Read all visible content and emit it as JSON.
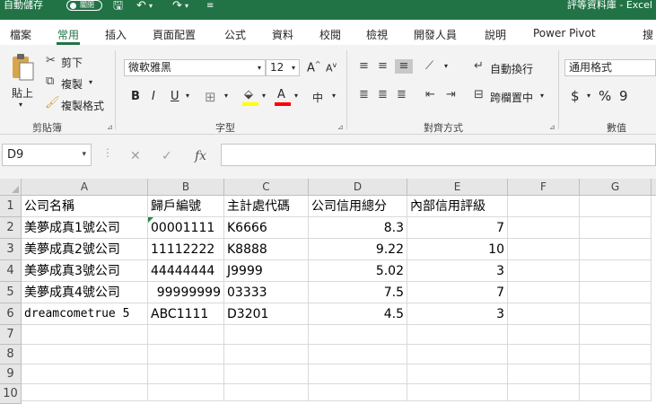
{
  "titlebar": {
    "autosave_label": "自動儲存",
    "autosave_state": "關閉",
    "title": "評等資料庫 - Excel"
  },
  "ribbon_tabs": [
    "檔案",
    "常用",
    "插入",
    "頁面配置",
    "公式",
    "資料",
    "校閱",
    "檢視",
    "開發人員",
    "說明",
    "Power Pivot",
    "搜"
  ],
  "active_tab": "常用",
  "clipboard": {
    "paste": "貼上",
    "cut": "剪下",
    "copy": "複製",
    "format_painter": "複製格式",
    "label": "剪貼簿"
  },
  "font": {
    "name": "微軟雅黑",
    "size": "12",
    "grow": "A",
    "shrink": "A",
    "bold": "B",
    "italic": "I",
    "underline": "U",
    "phonetic": "中",
    "label": "字型"
  },
  "alignment": {
    "wrap": "自動換行",
    "merge": "跨欄置中",
    "label": "對齊方式"
  },
  "number": {
    "format": "通用格式",
    "currency": "$",
    "percent": "%",
    "comma": "9",
    "label": "數值"
  },
  "formula_bar": {
    "name_box": "D9",
    "cancel": "✕",
    "enter": "✓",
    "fx": "fx",
    "formula": ""
  },
  "colors": {
    "accent": "#217346",
    "highlight": "#ffff00",
    "font_color": "#ff0000",
    "error_indicator": "#1e8a3f"
  },
  "sheet": {
    "columns": [
      "A",
      "B",
      "C",
      "D",
      "E",
      "F",
      "G"
    ],
    "row_numbers": [
      "1",
      "2",
      "3",
      "4",
      "5",
      "6",
      "7",
      "8",
      "9",
      "10"
    ],
    "rows": [
      [
        "公司名稱",
        "歸戶編號",
        "主計處代碼",
        "公司信用總分",
        "內部信用評級"
      ],
      [
        "美夢成真1號公司",
        "00001111",
        "K6666",
        "8.3",
        "7"
      ],
      [
        "美夢成真2號公司",
        "11112222",
        "K8888",
        "9.22",
        "10"
      ],
      [
        "美夢成真3號公司",
        "44444444",
        "J9999",
        "5.02",
        "3"
      ],
      [
        "美夢成真4號公司",
        "99999999",
        "03333",
        "7.5",
        "7"
      ],
      [
        "dreamcometrue 5",
        "ABC1111",
        "D3201",
        "4.5",
        "3"
      ]
    ]
  }
}
